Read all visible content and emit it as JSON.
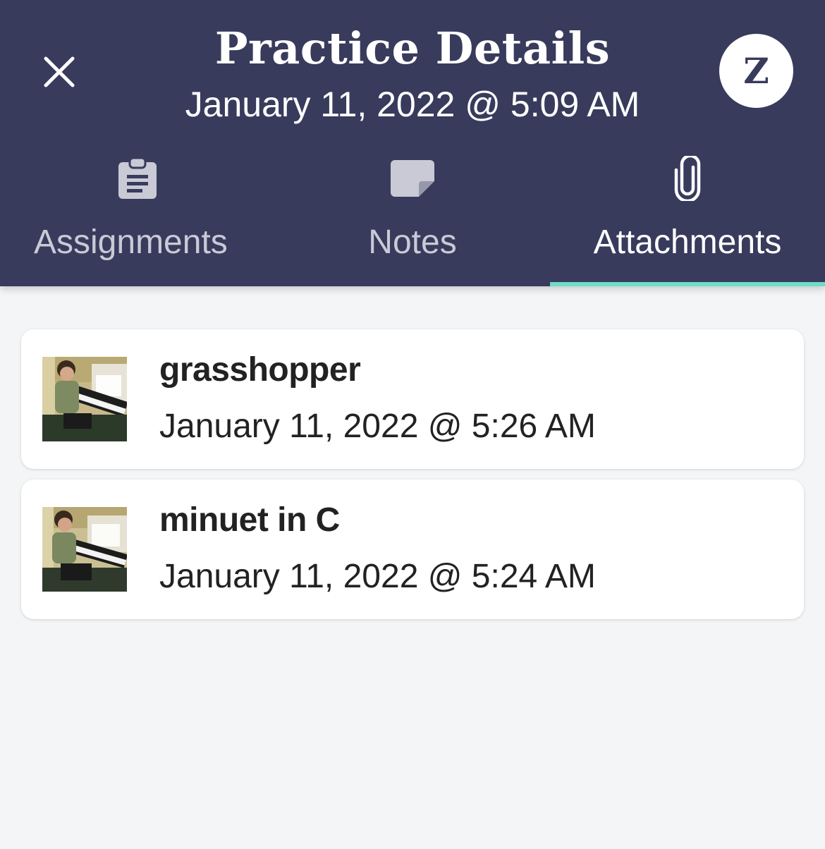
{
  "header": {
    "title": "Practice Details",
    "subtitle": "January 11, 2022 @ 5:09 AM",
    "avatar_initial": "Z"
  },
  "tabs": [
    {
      "label": "Assignments",
      "icon": "clipboard-icon",
      "active": false
    },
    {
      "label": "Notes",
      "icon": "note-icon",
      "active": false
    },
    {
      "label": "Attachments",
      "icon": "paperclip-icon",
      "active": true
    }
  ],
  "attachments": [
    {
      "name": "grasshopper",
      "date": "January 11, 2022 @ 5:26 AM",
      "thumbnail": "boy-playing-piano-photo"
    },
    {
      "name": "minuet in C",
      "date": "January 11, 2022 @ 5:24 AM",
      "thumbnail": "boy-playing-piano-photo"
    }
  ],
  "colors": {
    "header_bg": "#383b5c",
    "active_tab_indicator": "#6fdcc7",
    "page_bg": "#f4f5f7"
  }
}
